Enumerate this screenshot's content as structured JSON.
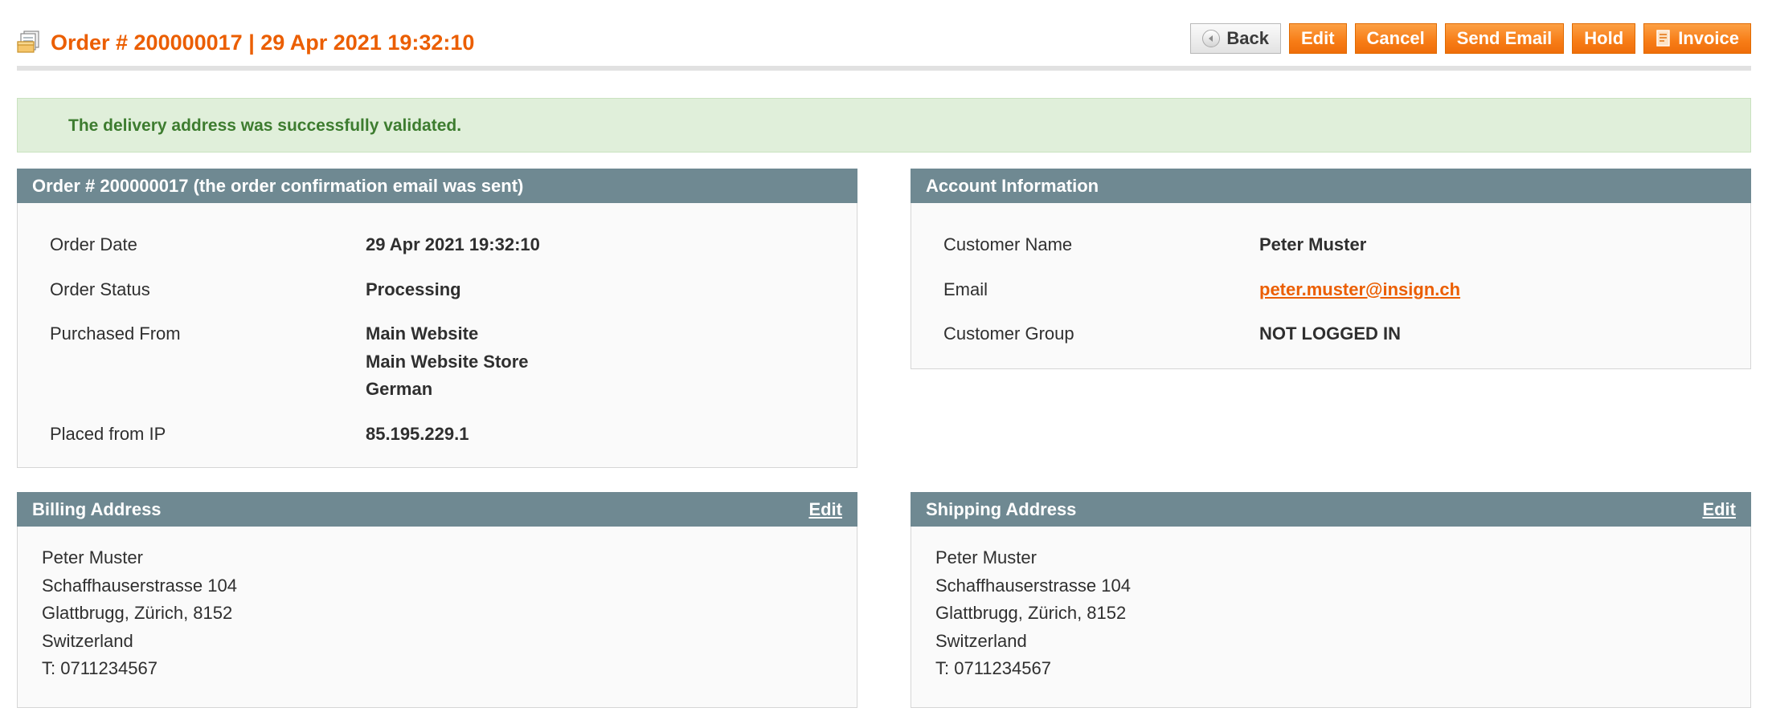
{
  "header": {
    "title": "Order # 200000017 | 29 Apr 2021 19:32:10",
    "icon": "order-document-icon",
    "buttons": {
      "back": "Back",
      "edit": "Edit",
      "cancel": "Cancel",
      "send_email": "Send Email",
      "hold": "Hold",
      "invoice": "Invoice"
    }
  },
  "message": {
    "text": "The delivery address was successfully validated."
  },
  "order_box": {
    "title": "Order # 200000017 (the order confirmation email was sent)",
    "order_date_label": "Order Date",
    "order_date": "29 Apr 2021 19:32:10",
    "order_status_label": "Order Status",
    "order_status": "Processing",
    "purchased_from_label": "Purchased From",
    "purchased_from": [
      "Main Website",
      "Main Website Store",
      "German"
    ],
    "ip_label": "Placed from IP",
    "ip": "85.195.229.1"
  },
  "account_box": {
    "title": "Account Information",
    "customer_name_label": "Customer Name",
    "customer_name": "Peter Muster",
    "email_label": "Email",
    "email": "peter.muster@insign.ch",
    "group_label": "Customer Group",
    "group": "NOT LOGGED IN"
  },
  "billing_box": {
    "title": "Billing Address",
    "edit_label": "Edit",
    "lines": [
      "Peter Muster",
      "Schaffhauserstrasse 104",
      "Glattbrugg, Zürich, 8152",
      "Switzerland",
      "T: 0711234567"
    ]
  },
  "shipping_box": {
    "title": "Shipping Address",
    "edit_label": "Edit",
    "lines": [
      "Peter Muster",
      "Schaffhauserstrasse 104",
      "Glattbrugg, Zürich, 8152",
      "Switzerland",
      "T: 0711234567"
    ]
  },
  "colors": {
    "accent": "#eb5e00",
    "box_header": "#6f8992",
    "success_bg": "#e0efda",
    "success_text": "#3d7c2f"
  }
}
